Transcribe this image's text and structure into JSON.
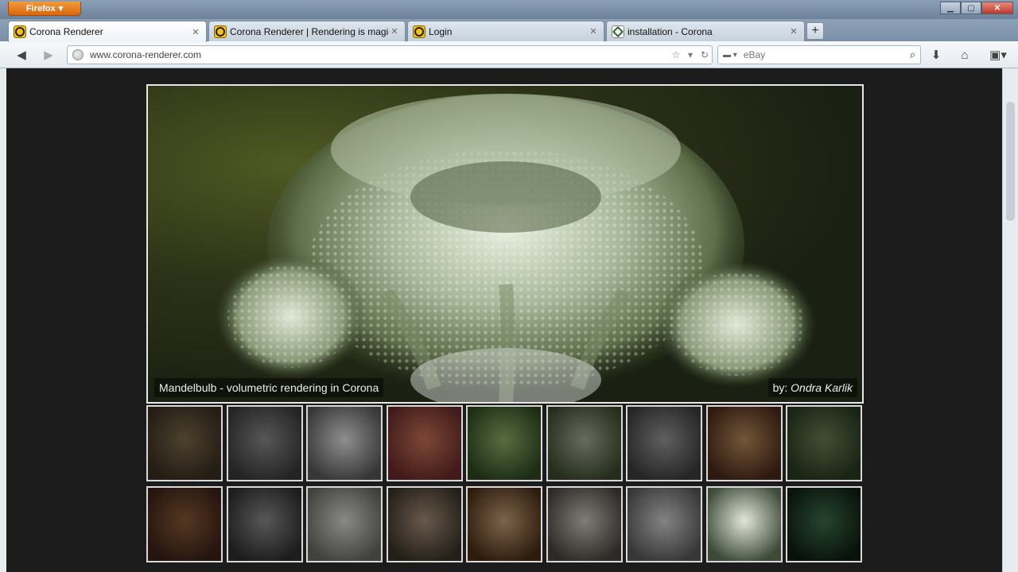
{
  "browser": {
    "app_button": "Firefox",
    "tabs": [
      {
        "label": "Corona Renderer",
        "active": true
      },
      {
        "label": "Corona Renderer | Rendering is magic",
        "active": false
      },
      {
        "label": "Login",
        "active": false
      },
      {
        "label": "installation - Corona",
        "active": false
      }
    ],
    "url": "www.corona-renderer.com",
    "search": {
      "engine": "eBay",
      "placeholder": "eBay"
    }
  },
  "hero": {
    "caption": "Mandelbulb - volumetric rendering in Corona",
    "credit_prefix": "by:",
    "credit_name": "Ondra",
    "credit_surname": "Karlik"
  },
  "gallery": {
    "thumbs": [
      {
        "c1": "#3a2f22",
        "c2": "#7a6a4a",
        "active": false
      },
      {
        "c1": "#3b3b3b",
        "c2": "#8c8c8c",
        "active": false
      },
      {
        "c1": "#5a5a5a",
        "c2": "#e6e6e6",
        "active": false
      },
      {
        "c1": "#6a2c2c",
        "c2": "#c9735a",
        "active": false
      },
      {
        "c1": "#2f4a22",
        "c2": "#8fb06a",
        "active": false
      },
      {
        "c1": "#3e4a30",
        "c2": "#a7ae95",
        "active": false
      },
      {
        "c1": "#3d3d3d",
        "c2": "#9a9a9a",
        "active": false
      },
      {
        "c1": "#4a2a1a",
        "c2": "#b98b5e",
        "active": false
      },
      {
        "c1": "#2a3a22",
        "c2": "#6d7d55",
        "active": false
      },
      {
        "c1": "#3c2218",
        "c2": "#8a5a3a",
        "active": false
      },
      {
        "c1": "#2f2f2f",
        "c2": "#8d8d8d",
        "active": false
      },
      {
        "c1": "#6a6a66",
        "c2": "#dcdcd6",
        "active": false
      },
      {
        "c1": "#3a3328",
        "c2": "#a8907a",
        "active": false
      },
      {
        "c1": "#4a2e18",
        "c2": "#caa27a",
        "active": false
      },
      {
        "c1": "#4a4540",
        "c2": "#cfc8c0",
        "active": false
      },
      {
        "c1": "#5a5a5a",
        "c2": "#d4d4d4",
        "active": false
      },
      {
        "c1": "#3d4a38",
        "c2": "#e2e6da",
        "active": true
      },
      {
        "c1": "#0f1f14",
        "c2": "#3e6e4a",
        "active": false
      }
    ]
  },
  "colors": {
    "accent": "#e87511",
    "page_bg": "#1c1c1c",
    "frame": "#e7e7e7"
  }
}
